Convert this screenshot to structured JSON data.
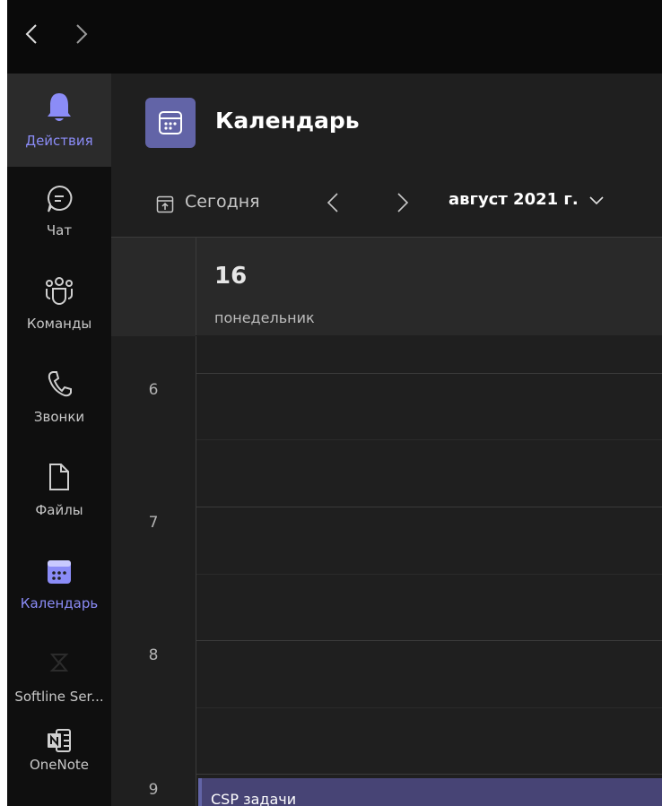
{
  "rail": {
    "items": [
      {
        "label": "Действия",
        "icon": "bell-icon"
      },
      {
        "label": "Чат",
        "icon": "chat-icon"
      },
      {
        "label": "Команды",
        "icon": "teams-icon"
      },
      {
        "label": "Звонки",
        "icon": "phone-icon"
      },
      {
        "label": "Файлы",
        "icon": "file-icon"
      },
      {
        "label": "Календарь",
        "icon": "calendar-icon"
      },
      {
        "label": "Softline Ser...",
        "icon": "app-icon"
      },
      {
        "label": "OneNote",
        "icon": "onenote-icon"
      }
    ]
  },
  "header": {
    "title": "Календарь"
  },
  "toolbar": {
    "today_label": "Сегодня",
    "month_label": "август 2021 г."
  },
  "day": {
    "number": "16",
    "name": "понедельник"
  },
  "hours": [
    "6",
    "7",
    "8",
    "9"
  ],
  "event": {
    "title": "CSP задачи"
  },
  "colors": {
    "accent": "#8b8cf7",
    "brand": "#6264a7",
    "event_bg": "#474475"
  }
}
